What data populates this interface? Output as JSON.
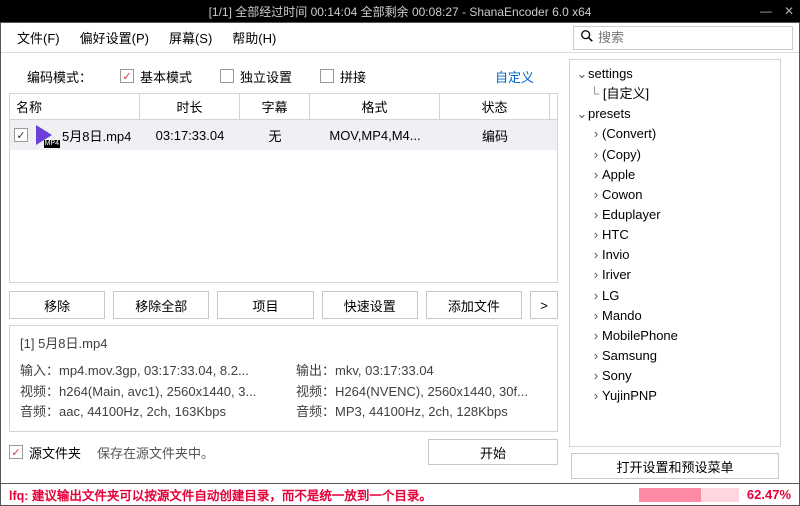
{
  "title": "[1/1] 全部经过时间  00:14:04 全部剩余  00:08:27  - ShanaEncoder  6.0  x64",
  "menu": {
    "file": "文件(F)",
    "pref": "偏好设置(P)",
    "screen": "屏幕(S)",
    "help": "帮助(H)"
  },
  "search": {
    "placeholder": "搜索"
  },
  "mode": {
    "label": "编码模式：",
    "basic": "基本模式",
    "independent": "独立设置",
    "concat": "拼接",
    "customize": "自定义"
  },
  "table": {
    "headers": {
      "name": "名称",
      "duration": "时长",
      "subtitle": "字幕",
      "format": "格式",
      "status": "状态"
    },
    "rows": [
      {
        "checked": true,
        "name": "5月8日.mp4",
        "duration": "03:17:33.04",
        "subtitle": "无",
        "format": "MOV,MP4,M4...",
        "status": "编码"
      }
    ]
  },
  "buttons": {
    "remove": "移除",
    "remove_all": "移除全部",
    "project": "项目",
    "quick_set": "快速设置",
    "add_file": "添加文件",
    "arrow": ">"
  },
  "info": {
    "title": "[1] 5月8日.mp4",
    "in_label": "输入：",
    "in_fmt": "mp4.mov.3gp, 03:17:33.04, 8.2...",
    "out_label": "输出：",
    "out_fmt": "mkv, 03:17:33.04",
    "in_vid_l": "视频：",
    "in_vid": "h264(Main, avc1), 2560x1440, 3...",
    "out_vid_l": "视频：",
    "out_vid": "H264(NVENC), 2560x1440, 30f...",
    "in_aud_l": "音频：",
    "in_aud": "aac, 44100Hz, 2ch, 163Kbps",
    "out_aud_l": "音频：",
    "out_aud": "MP3, 44100Hz, 2ch, 128Kbps"
  },
  "bottom": {
    "src_folder": "源文件夹",
    "save_in_src": "保存在源文件夹中。",
    "start": "开始"
  },
  "right": {
    "settings": "settings",
    "custom": "[自定义]",
    "presets": "presets",
    "items": [
      "(Convert)",
      "(Copy)",
      "Apple",
      "Cowon",
      "Eduplayer",
      "HTC",
      "Invio",
      "Iriver",
      "LG",
      "Mando",
      "MobilePhone",
      "Samsung",
      "Sony",
      "YujinPNP"
    ],
    "open_presets": "打开设置和预设菜单"
  },
  "status": {
    "msg": "lfq: 建议输出文件夹可以按源文件自动创建目录，而不是统一放到一个目录。",
    "pct": "62.47%",
    "fill_pct": 62.47
  }
}
